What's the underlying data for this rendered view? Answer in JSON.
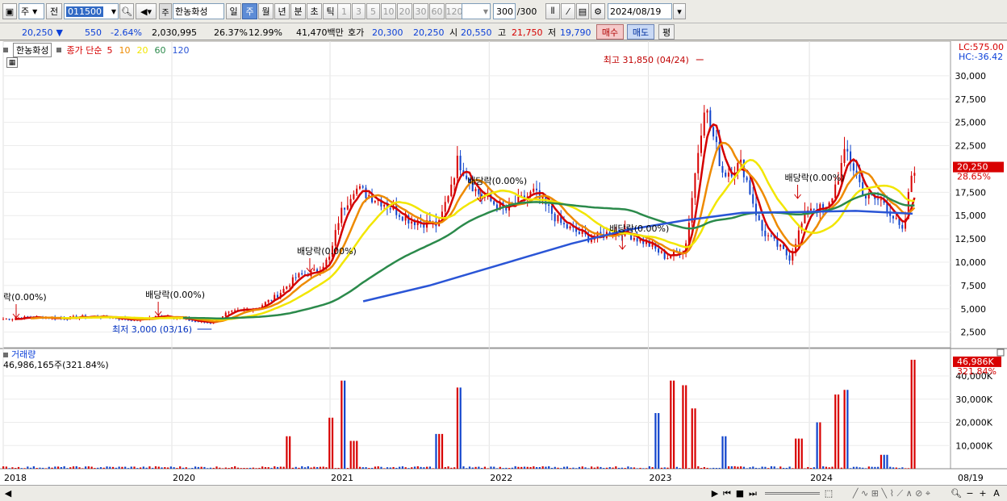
{
  "toolbar": {
    "period_label": "주",
    "prev_label": "전",
    "stock_code": "011500",
    "stock_tag": "주",
    "stock_name": "한농화성",
    "period_buttons": [
      {
        "label": "일",
        "active": false
      },
      {
        "label": "주",
        "active": true
      },
      {
        "label": "월",
        "active": false
      },
      {
        "label": "년",
        "active": false
      },
      {
        "label": "분",
        "active": false
      },
      {
        "label": "초",
        "active": false
      },
      {
        "label": "틱",
        "active": false
      }
    ],
    "interval_buttons": [
      "1",
      "3",
      "5",
      "10",
      "20",
      "30",
      "60",
      "120"
    ],
    "count_value": "300",
    "count_total": "/300",
    "date_value": "2024/08/19"
  },
  "quote": {
    "price": "20,250",
    "change": "550",
    "change_pct": "-2.64%",
    "volume": "2,030,995",
    "turnover_pct": "26.37%",
    "ratio_pct": "12.99%",
    "amount": "41,470백만",
    "bid_label": "호가",
    "bid1": "20,300",
    "bid2": "20,250",
    "open_label": "시",
    "open": "20,550",
    "high_label": "고",
    "high": "21,750",
    "low_label": "저",
    "low": "19,790",
    "buy_label": "매수",
    "sell_label": "매도",
    "eval_label": "평"
  },
  "chart_legend": {
    "name": "한농화성",
    "ma_label": "종가 단순",
    "ma_periods": [
      "5",
      "10",
      "20",
      "60",
      "120"
    ],
    "ma_colors": [
      "#d40000",
      "#ee8a00",
      "#f2e600",
      "#2b8a4b",
      "#2a55d6"
    ]
  },
  "lc_label": "LC:575.00",
  "hc_label": "HC:-36.42",
  "volume_legend": {
    "title": "거래량",
    "value": "46,986,165주(321.84%)"
  },
  "price_tag": {
    "price": "20,250",
    "pct": "28.65%"
  },
  "volume_tag": {
    "value": "46,986K",
    "pct": "321.84%"
  },
  "annotations": {
    "high_label": "최고 31,850 (04/24)",
    "low_label": "최저 3,000 (03/16)",
    "dividend": [
      "락(0.00%)",
      "배당락(0.00%)",
      "배당락(0.00%)",
      "배당락(0.00%)",
      "배당락(0.00%)",
      "배당락(0.00%)"
    ]
  },
  "x_axis": [
    "2018",
    "2020",
    "2021",
    "2022",
    "2023",
    "2024",
    "08/19"
  ],
  "chart_data": {
    "type": "line",
    "title": "한농화성",
    "y_ticks": [
      30000,
      27500,
      25000,
      22500,
      20000,
      17500,
      15000,
      12500,
      10000,
      7500,
      5000,
      2500
    ],
    "ylim": [
      1000,
      32500
    ],
    "volume_ticks": [
      "40,000K",
      "30,000K",
      "20,000K",
      "10,000K"
    ],
    "volume_ylim_k": [
      0,
      48000
    ],
    "x_years": [
      "2018",
      "2020",
      "2021",
      "2022",
      "2023",
      "2024"
    ],
    "close_series": [
      {
        "t": 0.0,
        "v": 3900
      },
      {
        "t": 0.03,
        "v": 4100
      },
      {
        "t": 0.06,
        "v": 4000
      },
      {
        "t": 0.1,
        "v": 4200
      },
      {
        "t": 0.14,
        "v": 3800
      },
      {
        "t": 0.17,
        "v": 4300
      },
      {
        "t": 0.2,
        "v": 3700
      },
      {
        "t": 0.22,
        "v": 3500
      },
      {
        "t": 0.235,
        "v": 4500
      },
      {
        "t": 0.25,
        "v": 4800
      },
      {
        "t": 0.27,
        "v": 5200
      },
      {
        "t": 0.29,
        "v": 6500
      },
      {
        "t": 0.31,
        "v": 8500
      },
      {
        "t": 0.33,
        "v": 9000
      },
      {
        "t": 0.345,
        "v": 10500
      },
      {
        "t": 0.355,
        "v": 15000
      },
      {
        "t": 0.37,
        "v": 18000
      },
      {
        "t": 0.4,
        "v": 16500
      },
      {
        "t": 0.43,
        "v": 14500
      },
      {
        "t": 0.46,
        "v": 14000
      },
      {
        "t": 0.48,
        "v": 21000
      },
      {
        "t": 0.5,
        "v": 17500
      },
      {
        "t": 0.53,
        "v": 15500
      },
      {
        "t": 0.56,
        "v": 17500
      },
      {
        "t": 0.59,
        "v": 14000
      },
      {
        "t": 0.62,
        "v": 12500
      },
      {
        "t": 0.65,
        "v": 13500
      },
      {
        "t": 0.68,
        "v": 12000
      },
      {
        "t": 0.7,
        "v": 10500
      },
      {
        "t": 0.72,
        "v": 11500
      },
      {
        "t": 0.74,
        "v": 27000
      },
      {
        "t": 0.76,
        "v": 19500
      },
      {
        "t": 0.78,
        "v": 20500
      },
      {
        "t": 0.8,
        "v": 13500
      },
      {
        "t": 0.83,
        "v": 10500
      },
      {
        "t": 0.85,
        "v": 16000
      },
      {
        "t": 0.87,
        "v": 15500
      },
      {
        "t": 0.89,
        "v": 22000
      },
      {
        "t": 0.91,
        "v": 17000
      },
      {
        "t": 0.93,
        "v": 16500
      },
      {
        "t": 0.95,
        "v": 13000
      },
      {
        "t": 0.96,
        "v": 20250
      }
    ],
    "ma120_series": [
      {
        "t": 0.38,
        "v": 5800
      },
      {
        "t": 0.45,
        "v": 7500
      },
      {
        "t": 0.5,
        "v": 9000
      },
      {
        "t": 0.55,
        "v": 10500
      },
      {
        "t": 0.6,
        "v": 12000
      },
      {
        "t": 0.66,
        "v": 13500
      },
      {
        "t": 0.72,
        "v": 14500
      },
      {
        "t": 0.78,
        "v": 15300
      },
      {
        "t": 0.85,
        "v": 15400
      },
      {
        "t": 0.9,
        "v": 15500
      },
      {
        "t": 0.96,
        "v": 15200
      }
    ],
    "volume_series_k": [
      {
        "t": 0.3,
        "v": 14000
      },
      {
        "t": 0.345,
        "v": 22000
      },
      {
        "t": 0.36,
        "v": 38000
      },
      {
        "t": 0.37,
        "v": 12000
      },
      {
        "t": 0.46,
        "v": 15000
      },
      {
        "t": 0.48,
        "v": 35000
      },
      {
        "t": 0.69,
        "v": 24000
      },
      {
        "t": 0.705,
        "v": 38000
      },
      {
        "t": 0.72,
        "v": 36000
      },
      {
        "t": 0.73,
        "v": 26000
      },
      {
        "t": 0.76,
        "v": 14000
      },
      {
        "t": 0.84,
        "v": 13000
      },
      {
        "t": 0.86,
        "v": 20000
      },
      {
        "t": 0.88,
        "v": 32000
      },
      {
        "t": 0.89,
        "v": 34000
      },
      {
        "t": 0.93,
        "v": 6000
      },
      {
        "t": 0.96,
        "v": 46986
      }
    ]
  }
}
